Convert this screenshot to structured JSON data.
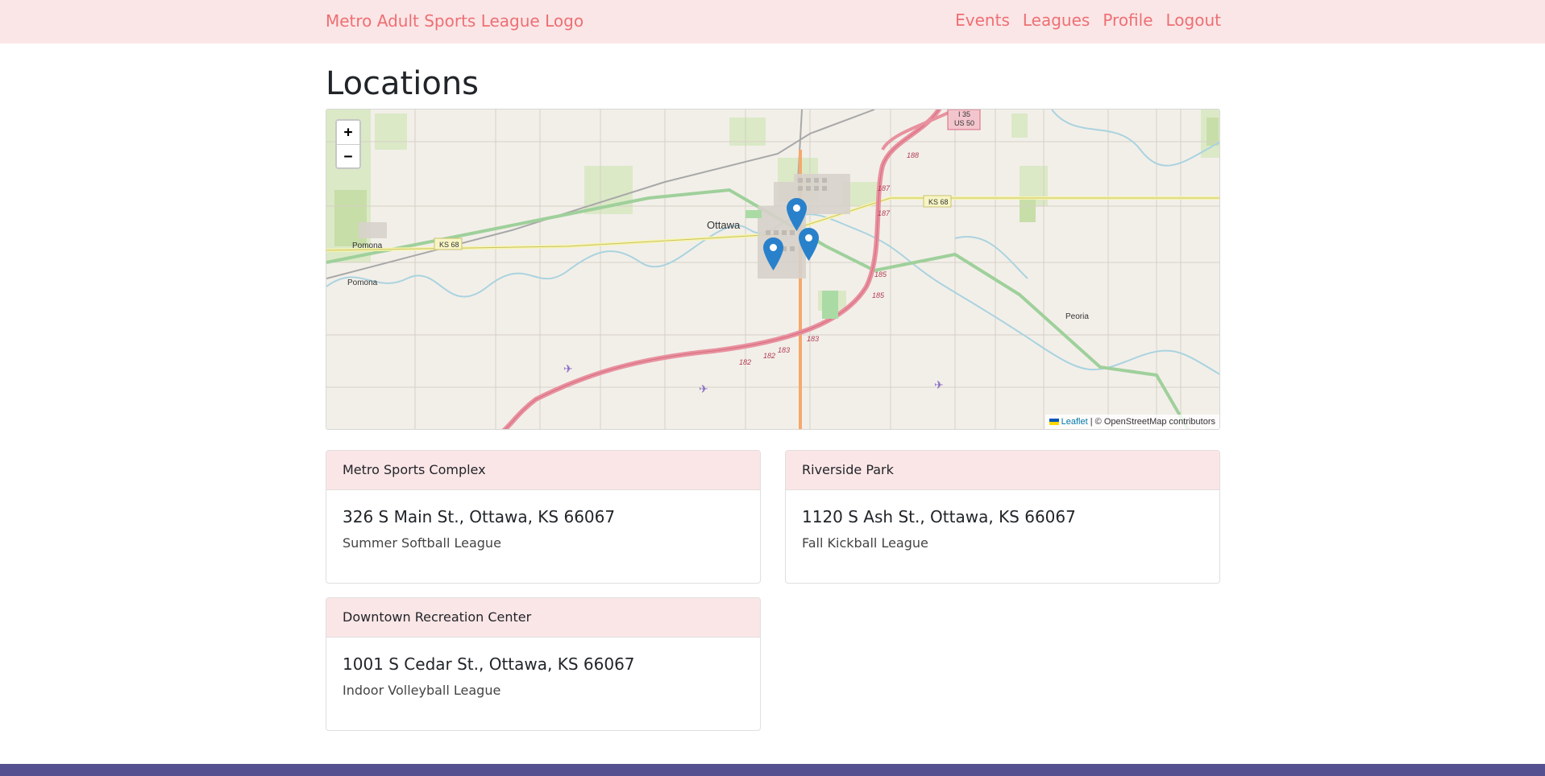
{
  "navbar": {
    "brand": "Metro Adult Sports League Logo",
    "links": [
      "Events",
      "Leagues",
      "Profile",
      "Logout"
    ]
  },
  "page": {
    "title": "Locations"
  },
  "map": {
    "zoom_in": "+",
    "zoom_out": "−",
    "attribution": {
      "leaflet": "Leaflet",
      "separator": " | ",
      "osm": "© OpenStreetMap contributors"
    },
    "labels": {
      "ottawa": "Ottawa",
      "pomona_upper": "Pomona",
      "pomona_lower": "Pomona",
      "peoria": "Peoria",
      "ks68_left": "KS 68",
      "ks68_right": "KS 68",
      "i35_line1": "I 35",
      "i35_line2": "US 50",
      "exit_188": "188",
      "exit_187a": "187",
      "exit_187b": "187",
      "exit_185a": "185",
      "exit_185b": "185",
      "exit_183a": "183",
      "exit_183b": "183",
      "exit_182a": "182",
      "exit_182b": "182"
    },
    "marker_color": "#2a81cb"
  },
  "locations": [
    {
      "name": "Metro Sports Complex",
      "address": "326 S Main St., Ottawa, KS 66067",
      "league": "Summer Softball League"
    },
    {
      "name": "Riverside Park",
      "address": "1120 S Ash St., Ottawa, KS 66067",
      "league": "Fall Kickball League"
    },
    {
      "name": "Downtown Recreation Center",
      "address": "1001 S Cedar St., Ottawa, KS 66067",
      "league": "Indoor Volleyball League"
    }
  ],
  "colors": {
    "navbar_bg": "#fbe6e7",
    "accent": "#ee6f73",
    "footer": "#55508f"
  }
}
